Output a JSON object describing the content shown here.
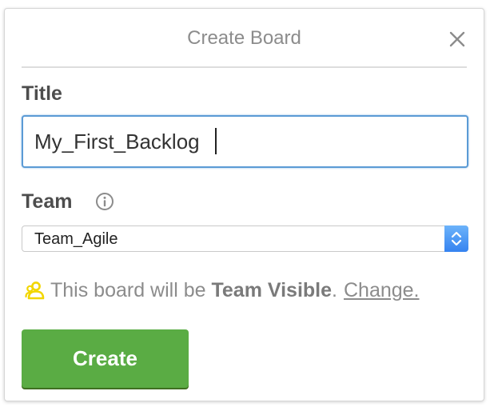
{
  "header": {
    "title": "Create Board"
  },
  "form": {
    "title_label": "Title",
    "title_value": "My_First_Backlog",
    "team_label": "Team",
    "team_selected": "Team_Agile",
    "visibility_prefix": "This board will be ",
    "visibility_level": "Team Visible",
    "visibility_period": ".",
    "change_link": "Change.",
    "create_label": "Create"
  },
  "icons": {
    "close": "close-icon",
    "info": "info-icon",
    "members": "members-icon",
    "select_arrows": "chevron-up-down-icon"
  },
  "colors": {
    "accent_green": "#5aac44",
    "focus_blue": "#5b9bd5",
    "members_icon_yellow": "#f2d600"
  }
}
